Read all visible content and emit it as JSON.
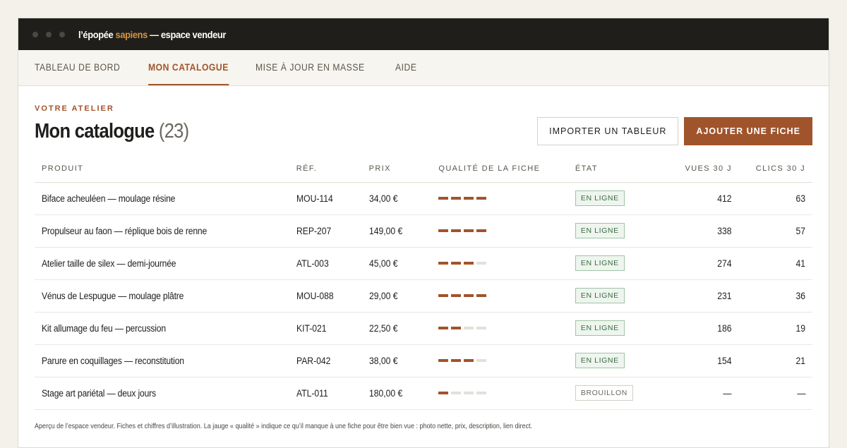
{
  "window": {
    "title_part1": "l’épopée ",
    "title_accent": "sapiens",
    "title_part2": " — espace vendeur"
  },
  "nav": {
    "tabs": [
      {
        "label": "TABLEAU DE BORD",
        "active": false
      },
      {
        "label": "MON CATALOGUE",
        "active": true
      },
      {
        "label": "MISE À JOUR EN MASSE",
        "active": false
      },
      {
        "label": "AIDE",
        "active": false
      }
    ]
  },
  "header": {
    "eyebrow": "VOTRE ATELIER",
    "title": "Mon catalogue",
    "count": "(23)",
    "import_label": "IMPORTER UN TABLEUR",
    "add_label": "AJOUTER UNE FICHE"
  },
  "table": {
    "columns": {
      "produit": "PRODUIT",
      "ref": "RÉF.",
      "prix": "PRIX",
      "qualite": "QUALITÉ DE LA FICHE",
      "etat": "ÉTAT",
      "vues": "VUES 30 J",
      "clics": "CLICS 30 J"
    },
    "rows": [
      {
        "produit": "Biface acheuléen — moulage résine",
        "ref": "MOU-114",
        "prix": "34,00 €",
        "quality": 4,
        "etat": "EN LIGNE",
        "vues": "412",
        "clics": "63"
      },
      {
        "produit": "Propulseur au faon — réplique bois de renne",
        "ref": "REP-207",
        "prix": "149,00 €",
        "quality": 4,
        "etat": "EN LIGNE",
        "vues": "338",
        "clics": "57"
      },
      {
        "produit": "Atelier taille de silex — demi-journée",
        "ref": "ATL-003",
        "prix": "45,00 €",
        "quality": 3,
        "etat": "EN LIGNE",
        "vues": "274",
        "clics": "41"
      },
      {
        "produit": "Vénus de Lespugue — moulage plâtre",
        "ref": "MOU-088",
        "prix": "29,00 €",
        "quality": 4,
        "etat": "EN LIGNE",
        "vues": "231",
        "clics": "36"
      },
      {
        "produit": "Kit allumage du feu — percussion",
        "ref": "KIT-021",
        "prix": "22,50 €",
        "quality": 2,
        "etat": "EN LIGNE",
        "vues": "186",
        "clics": "19"
      },
      {
        "produit": "Parure en coquillages — reconstitution",
        "ref": "PAR-042",
        "prix": "38,00 €",
        "quality": 3,
        "etat": "EN LIGNE",
        "vues": "154",
        "clics": "21"
      },
      {
        "produit": "Stage art pariétal — deux jours",
        "ref": "ATL-011",
        "prix": "180,00 €",
        "quality": 1,
        "etat": "BROUILLON",
        "vues": "—",
        "clics": "—"
      }
    ],
    "quality_max": 4
  },
  "footnote": "Aperçu de l’espace vendeur. Fiches et chiffres d’illustration. La jauge « qualité » indique ce qu’il manque à une fiche pour être bien vue : photo nette, prix, description, lien direct.",
  "colors": {
    "accent": "#a0542b",
    "titlebar": "#1f1e1b",
    "title_accent": "#d9913f",
    "online_badge": "#3b6a43"
  }
}
